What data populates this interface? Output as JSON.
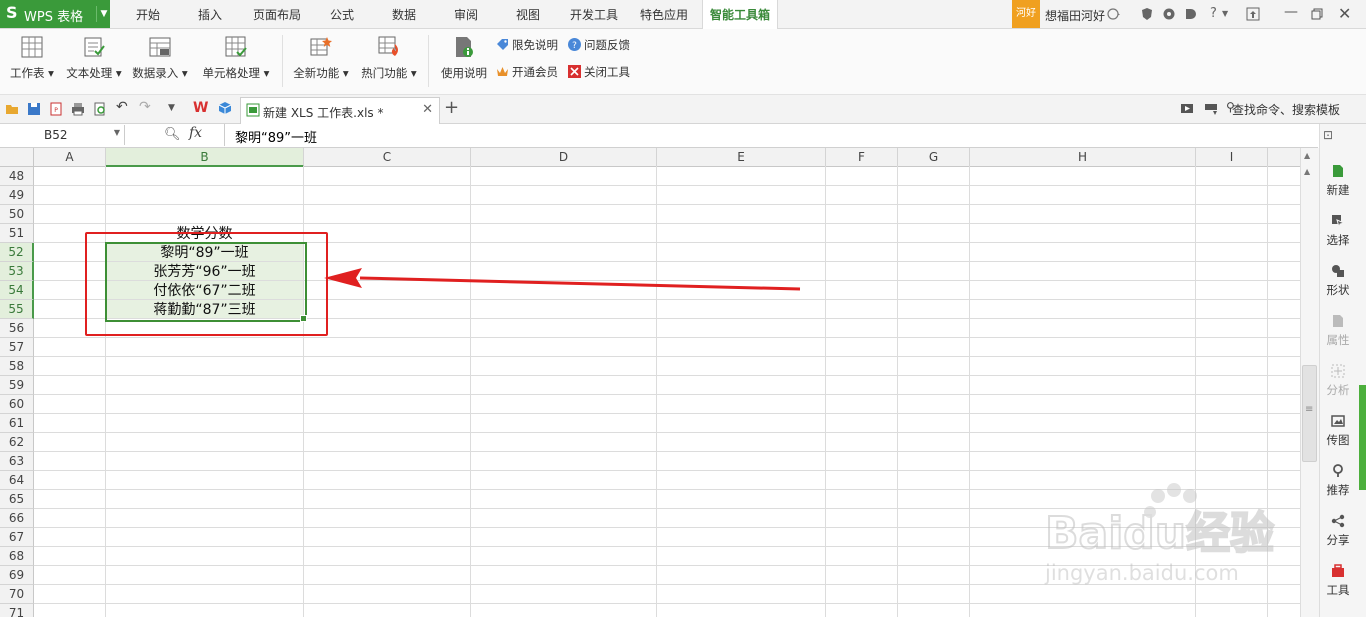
{
  "menubar": {
    "logo": "WPS 表格",
    "tabs": [
      "开始",
      "插入",
      "页面布局",
      "公式",
      "数据",
      "审阅",
      "视图",
      "开发工具",
      "特色应用",
      "智能工具箱"
    ],
    "active_tab": "智能工具箱",
    "badge": "河好",
    "user": "想福田河好"
  },
  "ribbon": {
    "buttons": [
      "工作表",
      "文本处理",
      "数据录入",
      "单元格处理",
      "全新功能",
      "热门功能",
      "使用说明"
    ],
    "small": [
      "限免说明",
      "问题反馈",
      "开通会员",
      "关闭工具"
    ]
  },
  "doc": {
    "tab_title": "新建 XLS 工作表.xls *",
    "search_placeholder": "查找命令、搜索模板"
  },
  "formula": {
    "name_box": "B52",
    "fx": "fx",
    "content": "黎明“89”一班"
  },
  "grid": {
    "columns": [
      "A",
      "B",
      "C",
      "D",
      "E",
      "F",
      "G",
      "H",
      "I"
    ],
    "rows": [
      "48",
      "49",
      "50",
      "51",
      "52",
      "53",
      "54",
      "55",
      "56",
      "57",
      "58",
      "59",
      "60",
      "61",
      "62",
      "63",
      "64",
      "65",
      "66",
      "67",
      "68",
      "69",
      "70",
      "71"
    ],
    "cells": {
      "b51": "数学分数",
      "b52": "黎明“89”一班",
      "b53": "张芳芳“96”一班",
      "b54": "付依依“67”二班",
      "b55": "蒋勤勤“87”三班"
    }
  },
  "side_panel": [
    "新建",
    "选择",
    "形状",
    "属性",
    "分析",
    "传图",
    "推荐",
    "分享",
    "工具"
  ],
  "watermark": {
    "brand": "Baidu经验",
    "url": "jingyan.baidu.com"
  },
  "colors": {
    "accent_green": "#3a9a3a",
    "annotation_red": "#e02020"
  }
}
